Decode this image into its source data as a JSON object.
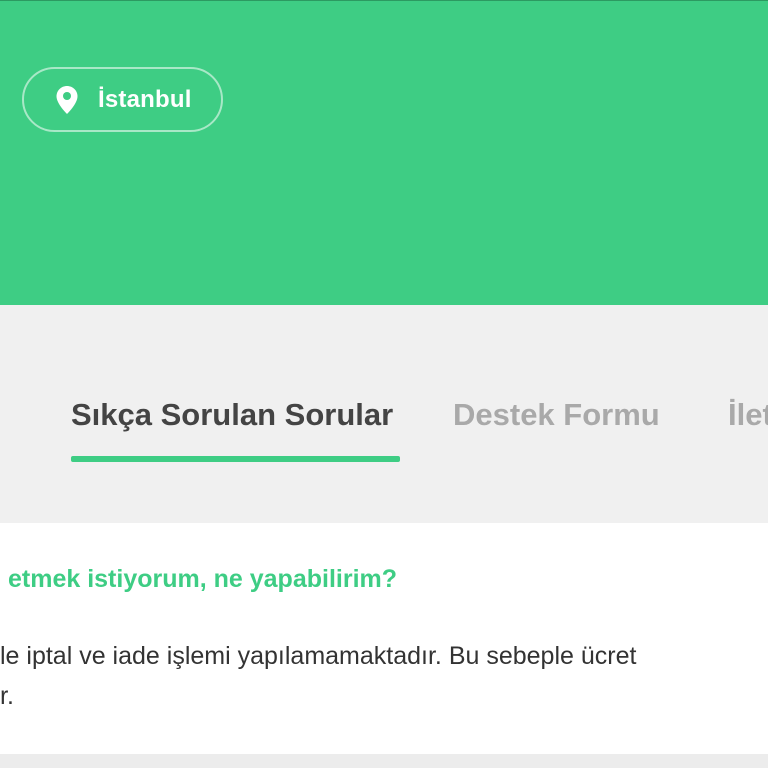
{
  "header": {
    "location": {
      "icon": "location-pin-icon",
      "city": "İstanbul"
    },
    "accent_color": "#3ecd84"
  },
  "tabs": [
    {
      "label": "Sıkça Sorulan Sorular",
      "active": true
    },
    {
      "label": "Destek Formu",
      "active": false
    },
    {
      "label": "İlet",
      "active": false
    }
  ],
  "faq": {
    "question": "etmek istiyorum, ne yapabilirim?",
    "answer_line1": "le iptal ve iade işlemi yapılamamaktadır. Bu sebeple ücret",
    "answer_line2": "r."
  }
}
